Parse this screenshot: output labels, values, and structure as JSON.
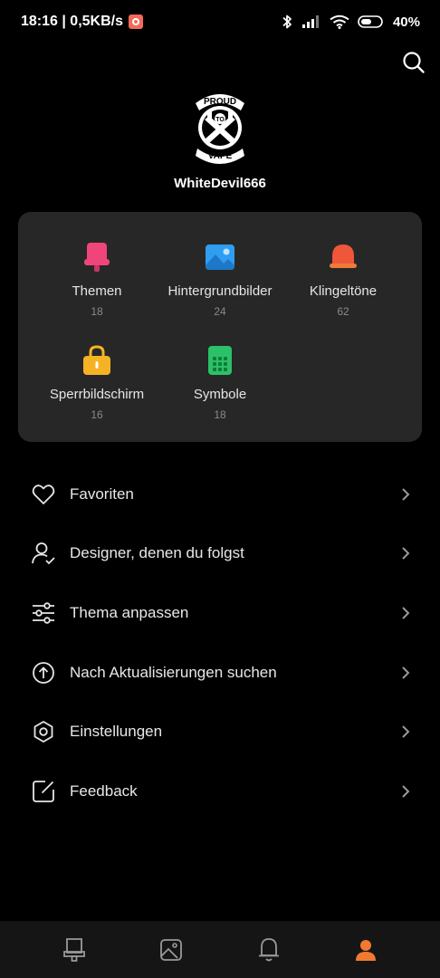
{
  "status_bar": {
    "time_speed": "18:16 | 0,5KB/s",
    "battery": "40%",
    "icons": [
      "bluetooth-icon",
      "signal-icon",
      "wifi-icon",
      "battery-icon"
    ]
  },
  "profile": {
    "avatar_text_top": "PROUD",
    "avatar_text_mid": "TO",
    "avatar_text_bottom": "VAPE",
    "username": "WhiteDevil666"
  },
  "categories": [
    {
      "label": "Themen",
      "count": "18",
      "icon": "theme-icon",
      "color": "#f0457a"
    },
    {
      "label": "Hintergrundbilder",
      "count": "24",
      "icon": "wallpaper-icon",
      "color": "#2f9df2"
    },
    {
      "label": "Klingeltöne",
      "count": "62",
      "icon": "bell-icon",
      "color": "#f0563a"
    },
    {
      "label": "Sperrbildschirm",
      "count": "16",
      "icon": "lock-icon",
      "color": "#f5b324"
    },
    {
      "label": "Symbole",
      "count": "18",
      "icon": "apps-icon",
      "color": "#2bc167"
    }
  ],
  "menu": [
    {
      "label": "Favoriten",
      "icon": "heart-icon"
    },
    {
      "label": "Designer, denen du folgst",
      "icon": "user-check-icon"
    },
    {
      "label": "Thema anpassen",
      "icon": "sliders-icon"
    },
    {
      "label": "Nach Aktualisierungen suchen",
      "icon": "update-icon"
    },
    {
      "label": "Einstellungen",
      "icon": "settings-icon"
    },
    {
      "label": "Feedback",
      "icon": "feedback-icon"
    }
  ],
  "bottom_nav": {
    "items": [
      "themes-tab-icon",
      "wallpapers-tab-icon",
      "ringtones-tab-icon",
      "profile-tab-icon"
    ],
    "active_color": "#f27a30"
  }
}
